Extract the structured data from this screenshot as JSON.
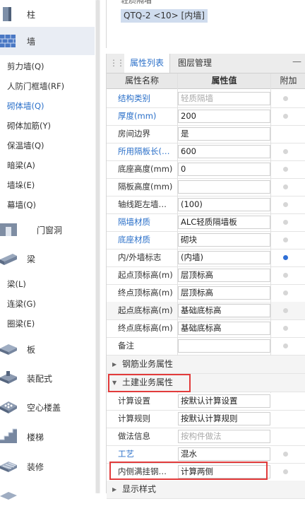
{
  "nav": {
    "categories": [
      {
        "key": "column",
        "label": "柱",
        "icon": "column-icon"
      },
      {
        "key": "wall",
        "label": "墙",
        "icon": "brick-wall-icon"
      },
      {
        "key": "door",
        "label": "门窗洞",
        "icon": "door-window-icon"
      },
      {
        "key": "beam",
        "label": "梁",
        "icon": "beam-icon"
      },
      {
        "key": "slab",
        "label": "板",
        "icon": "slab-icon"
      },
      {
        "key": "prefab",
        "label": "装配式",
        "icon": "prefab-icon"
      },
      {
        "key": "hollow",
        "label": "空心楼盖",
        "icon": "hollow-slab-icon"
      },
      {
        "key": "stair",
        "label": "楼梯",
        "icon": "stair-icon"
      },
      {
        "key": "decor",
        "label": "装修",
        "icon": "decoration-icon"
      }
    ],
    "wall_items": [
      "剪力墙(Q)",
      "人防门框墙(RF)",
      "砌体墙(Q)",
      "砌体加筋(Y)",
      "保温墙(Q)",
      "暗梁(A)",
      "墙垛(E)",
      "幕墙(Q)"
    ],
    "beam_items": [
      "梁(L)",
      "连梁(G)",
      "圈梁(E)"
    ]
  },
  "top_list": {
    "header": "轻质隔墙",
    "selected_item": "QTQ-2 <10> [内墙]"
  },
  "panel": {
    "tabs": {
      "properties": "属性列表",
      "layers": "图层管理"
    },
    "columns": {
      "name": "属性名称",
      "value": "属性值",
      "extra": "附加"
    },
    "rows": [
      {
        "name": "结构类别",
        "value": "轻质隔墙",
        "blue": true,
        "gray": true,
        "dot": "off"
      },
      {
        "name": "厚度(mm)",
        "value": "200",
        "blue": true,
        "gray": false,
        "dot": "off"
      },
      {
        "name": "房间边界",
        "value": "是",
        "blue": false,
        "gray": false,
        "dot": "none"
      },
      {
        "name": "所用隔板长(…",
        "value": "600",
        "blue": true,
        "gray": false,
        "dot": "off"
      },
      {
        "name": "底座高度(mm)",
        "value": "0",
        "blue": false,
        "gray": false,
        "dot": "off"
      },
      {
        "name": "隔板高度(mm)",
        "value": "",
        "blue": false,
        "gray": false,
        "dot": "off"
      },
      {
        "name": "轴线距左墙…",
        "value": "(100)",
        "blue": false,
        "gray": false,
        "dot": "off"
      },
      {
        "name": "隔墙材质",
        "value": "ALC轻质隔墙板",
        "blue": true,
        "gray": false,
        "dot": "off"
      },
      {
        "name": "底座材质",
        "value": "砌块",
        "blue": true,
        "gray": false,
        "dot": "off"
      },
      {
        "name": "内/外墙标志",
        "value": "(内墙)",
        "blue": false,
        "gray": false,
        "dot": "on"
      },
      {
        "name": "起点顶标高(m)",
        "value": "层顶标高",
        "blue": false,
        "gray": false,
        "dot": "off"
      },
      {
        "name": "终点顶标高(m)",
        "value": "层顶标高",
        "blue": false,
        "gray": false,
        "dot": "off"
      },
      {
        "name": "起点底标高(m)",
        "value": "基础底标高",
        "blue": false,
        "gray": false,
        "dot": "off"
      },
      {
        "name": "终点底标高(m)",
        "value": "基础底标高",
        "blue": false,
        "gray": false,
        "dot": "off"
      },
      {
        "name": "备注",
        "value": "",
        "blue": false,
        "gray": false,
        "dot": "off"
      }
    ],
    "group_rebar": "钢筋业务属性",
    "group_civil": "土建业务属性",
    "civil_rows": [
      {
        "name": "计算设置",
        "value": "按默认计算设置",
        "blue": false,
        "gray": false,
        "dot": "none"
      },
      {
        "name": "计算规则",
        "value": "按默认计算规则",
        "blue": false,
        "gray": false,
        "dot": "none"
      },
      {
        "name": "做法信息",
        "value": "按构件做法",
        "blue": false,
        "gray": true,
        "dot": "none"
      },
      {
        "name": "工艺",
        "value": "混水",
        "blue": true,
        "gray": false,
        "dot": "off"
      },
      {
        "name": "内侧满挂钢…",
        "value": "计算两侧",
        "blue": false,
        "gray": false,
        "dot": "off"
      }
    ],
    "group_display": "显示样式"
  }
}
